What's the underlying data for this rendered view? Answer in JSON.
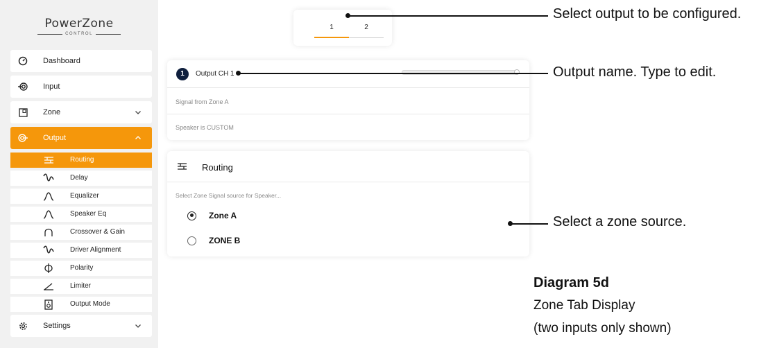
{
  "app": {
    "logo_title": "PowerZone",
    "logo_subtitle": "CONTROL"
  },
  "sidebar": {
    "items": [
      {
        "label": "Dashboard",
        "icon": "gauge-icon"
      },
      {
        "label": "Input",
        "icon": "input-icon"
      },
      {
        "label": "Zone",
        "icon": "zone-icon"
      },
      {
        "label": "Output",
        "icon": "output-icon"
      }
    ],
    "sub_items": [
      {
        "label": "Routing",
        "icon": "routing-icon"
      },
      {
        "label": "Delay",
        "icon": "delay-wave-icon"
      },
      {
        "label": "Equalizer",
        "icon": "equalizer-curve-icon"
      },
      {
        "label": "Speaker Eq",
        "icon": "speaker-eq-curve-icon"
      },
      {
        "label": "Crossover & Gain",
        "icon": "crossover-arch-icon"
      },
      {
        "label": "Driver Alignment",
        "icon": "driver-alignment-wave-icon"
      },
      {
        "label": "Polarity",
        "icon": "polarity-phi-icon"
      },
      {
        "label": "Limiter",
        "icon": "limiter-icon"
      },
      {
        "label": "Output Mode",
        "icon": "speaker-box-icon"
      }
    ],
    "settings_label": "Settings",
    "active_item": "Output",
    "active_sub_item": "Routing"
  },
  "tabs": {
    "items": [
      "1",
      "2"
    ],
    "selected": "1"
  },
  "output_card": {
    "badge": "1",
    "name": "Output CH 1",
    "signal_text": "Signal from Zone A",
    "speaker_text": "Speaker is CUSTOM"
  },
  "routing_card": {
    "title": "Routing",
    "subtitle": "Select Zone Signal source for Speaker...",
    "options": [
      {
        "label": "Zone A",
        "checked": true
      },
      {
        "label": "ZONE B",
        "checked": false
      }
    ]
  },
  "annotations": {
    "tab_note": "Select output to be configured.",
    "name_note": "Output name. Type to edit.",
    "zone_note": "Select a zone source."
  },
  "caption": {
    "title": "Diagram 5d",
    "line1": "Zone Tab Display",
    "line2": "(two inputs only shown)"
  },
  "colors": {
    "accent": "#f5970b",
    "badge": "#0f1f3d",
    "sidebar_bg": "#f1f1f1"
  }
}
